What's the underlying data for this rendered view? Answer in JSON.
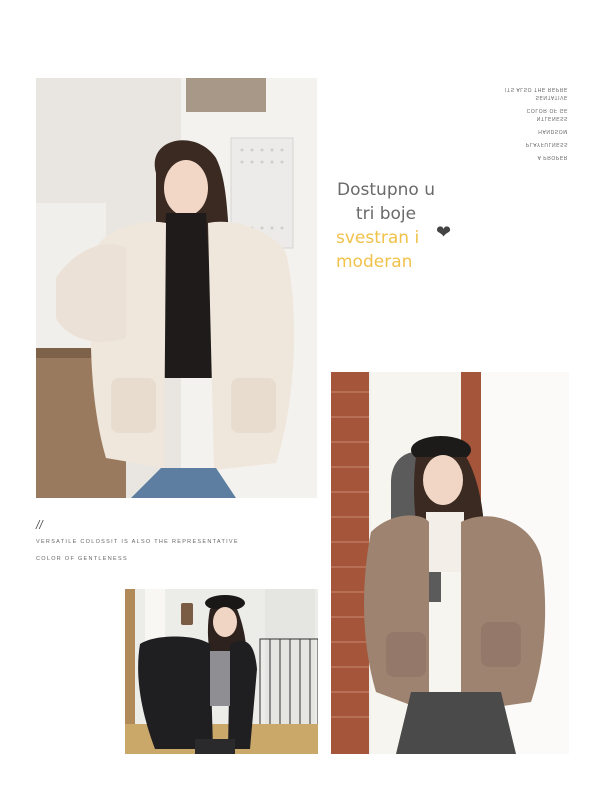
{
  "notes": {
    "line1": "ITS ALSO THE REPRE",
    "line1b": "SENTATIVE",
    "line2": "COLOR OF GE",
    "line2b": "NTLENESS",
    "line3": "HANDSOM",
    "line4": "PLAYFULNESS",
    "line5": "A PROPER"
  },
  "headline": {
    "line1": "Dostupno u",
    "line2": "tri boje",
    "line3": "svestran i",
    "line4": "moderan",
    "heart": "❤"
  },
  "caption": {
    "slash": "//",
    "line1": "VERSATILE COLOSSIT IS ALSO THE REPRESENTATIVE",
    "line2": "COLOR OF GENTLENESS"
  },
  "colors": {
    "accent_yellow": "#f1c24a",
    "text_gray": "#6a6a6a"
  }
}
